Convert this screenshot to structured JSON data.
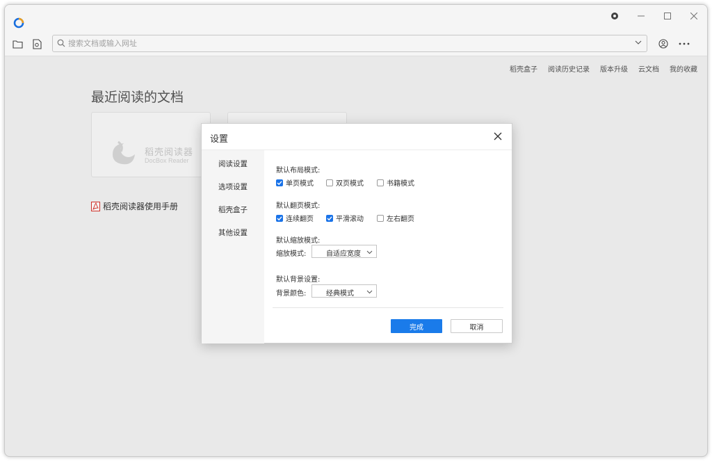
{
  "app": {
    "accent_color": "#1a73e8"
  },
  "toolbar": {
    "search_placeholder": "搜索文档或输入网址"
  },
  "top_links": [
    "稻壳盒子",
    "阅读历史记录",
    "版本升级",
    "云文档",
    "我的收藏"
  ],
  "recent": {
    "title": "最近阅读的文档",
    "card_brand": "稻壳阅读器",
    "card_brand_sub": "DocBox Reader",
    "doc_name": "稻壳阅读器使用手册"
  },
  "dialog": {
    "title": "设置",
    "sidebar": [
      "阅读设置",
      "选项设置",
      "稻壳盒子",
      "其他设置"
    ],
    "layout": {
      "label": "默认布局模式:",
      "options": [
        {
          "label": "单页模式",
          "checked": true
        },
        {
          "label": "双页模式",
          "checked": false
        },
        {
          "label": "书籍模式",
          "checked": false
        }
      ]
    },
    "paging": {
      "label": "默认翻页模式:",
      "options": [
        {
          "label": "连续翻页",
          "checked": true
        },
        {
          "label": "平滑滚动",
          "checked": true
        },
        {
          "label": "左右翻页",
          "checked": false
        }
      ]
    },
    "zoom": {
      "label": "默认缩放模式:",
      "field_label": "缩放模式:",
      "value": "自适应宽度"
    },
    "background": {
      "label": "默认背景设置:",
      "field_label": "背景颜色:",
      "value": "经典模式"
    },
    "ok_label": "完成",
    "cancel_label": "取消"
  }
}
